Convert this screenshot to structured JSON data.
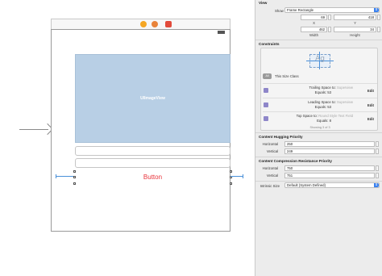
{
  "canvas": {
    "image_view_label": "UIImageView",
    "button_label": "Button"
  },
  "inspector": {
    "view": {
      "title": "View",
      "show_label": "Show",
      "show_value": "Frame Rectangle",
      "x": "69",
      "y": "418",
      "x_caption": "X",
      "y_caption": "Y",
      "width": "462",
      "height": "34",
      "width_caption": "Width",
      "height_caption": "Height"
    },
    "constraints": {
      "title": "Constraints",
      "preview_text": "Ag",
      "all_button": "All",
      "size_class_label": "This Size Class",
      "items": [
        {
          "line1": "Trailing Space to:",
          "value1": "Superview",
          "line2": "Equals:",
          "value2": "53",
          "edit": "Edit"
        },
        {
          "line1": "Leading Space to:",
          "value1": "Superview",
          "line2": "Equals:",
          "value2": "53",
          "edit": "Edit"
        },
        {
          "line1": "Top Space to:",
          "value1": "Round Style Text Field",
          "line2": "Equals:",
          "value2": "8",
          "edit": "Edit"
        }
      ],
      "showing": "Showing 3 of 3"
    },
    "hugging": {
      "title": "Content Hugging Priority",
      "horizontal_label": "Horizontal",
      "horizontal_value": "250",
      "vertical_label": "Vertical",
      "vertical_value": "249"
    },
    "compression": {
      "title": "Content Compression Resistance Priority",
      "horizontal_label": "Horizontal",
      "horizontal_value": "750",
      "vertical_label": "Vertical",
      "vertical_value": "751"
    },
    "intrinsic": {
      "label": "Intrinsic Size",
      "value": "Default (System Defined)"
    }
  },
  "colors": {
    "accent": "#3b82f0",
    "button_text": "#e8333a",
    "image_view_fill": "#b8cfe5",
    "constraint_line": "#4a90d9"
  },
  "icons": [
    "arrow-right-icon",
    "view-controller-icon",
    "first-responder-icon",
    "exit-icon",
    "battery-icon",
    "constraint-icon",
    "popup-arrow-icon"
  ]
}
